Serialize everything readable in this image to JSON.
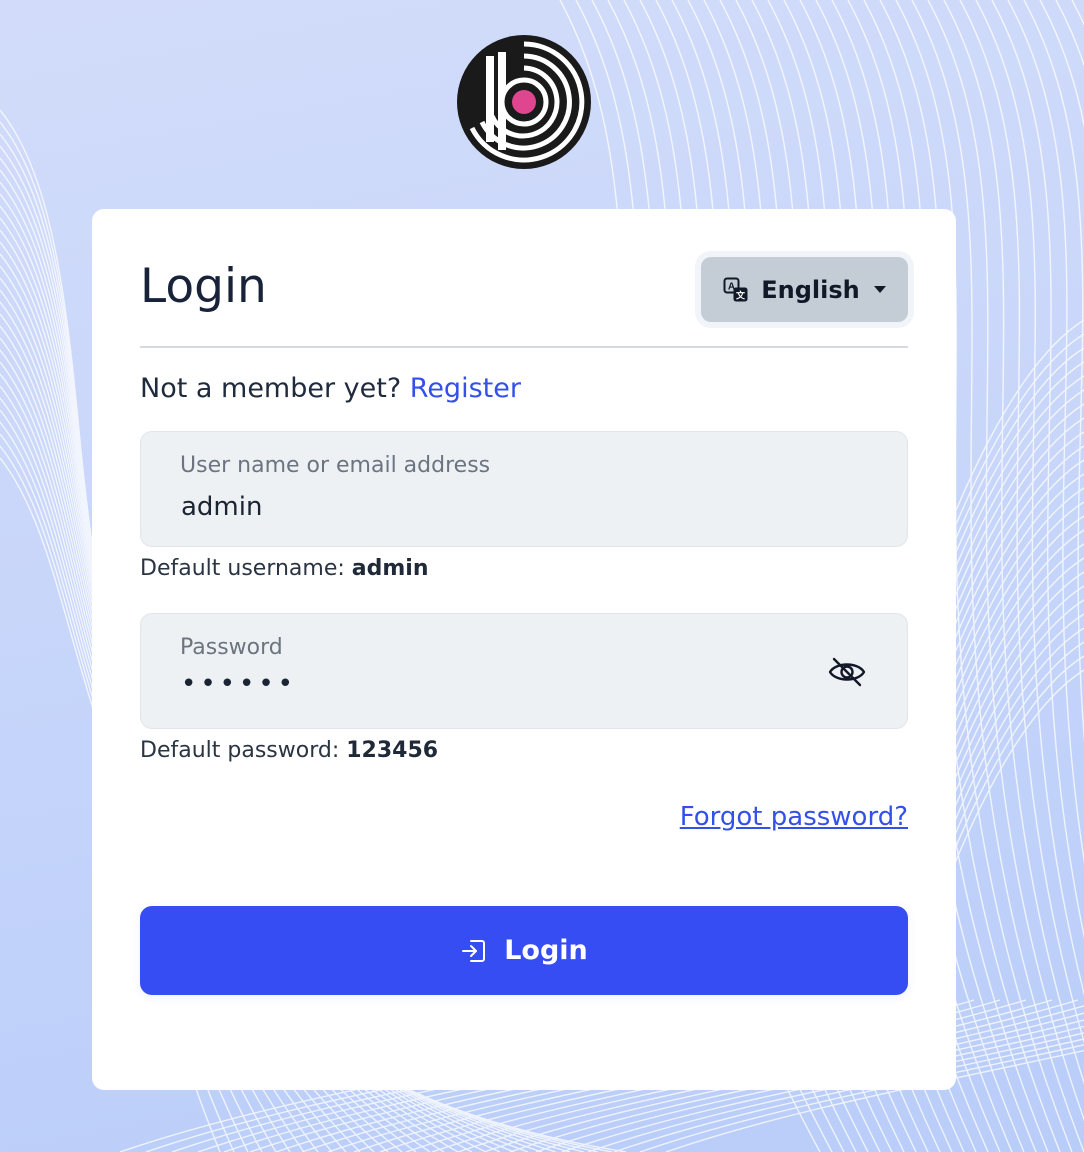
{
  "page": {
    "title": "Login"
  },
  "language": {
    "selected": "English"
  },
  "register": {
    "prompt": "Not a member yet?",
    "link_label": "Register"
  },
  "username": {
    "label": "User name or email address",
    "value": "admin",
    "hint_prefix": "Default username:",
    "hint_value": "admin"
  },
  "password": {
    "label": "Password",
    "masked_value": "••••••",
    "hint_prefix": "Default password:",
    "hint_value": "123456"
  },
  "forgot": {
    "label": "Forgot password?"
  },
  "submit": {
    "label": "Login"
  },
  "icons": {
    "logo": "app-logo",
    "language": "translate-icon",
    "caret": "caret-down-icon",
    "password_toggle": "eye-off-icon",
    "login": "sign-in-icon"
  },
  "colors": {
    "accent": "#364df3",
    "link": "#3450ea",
    "logo_dot": "#e0458f",
    "logo_ring": "#1a1a1a"
  }
}
